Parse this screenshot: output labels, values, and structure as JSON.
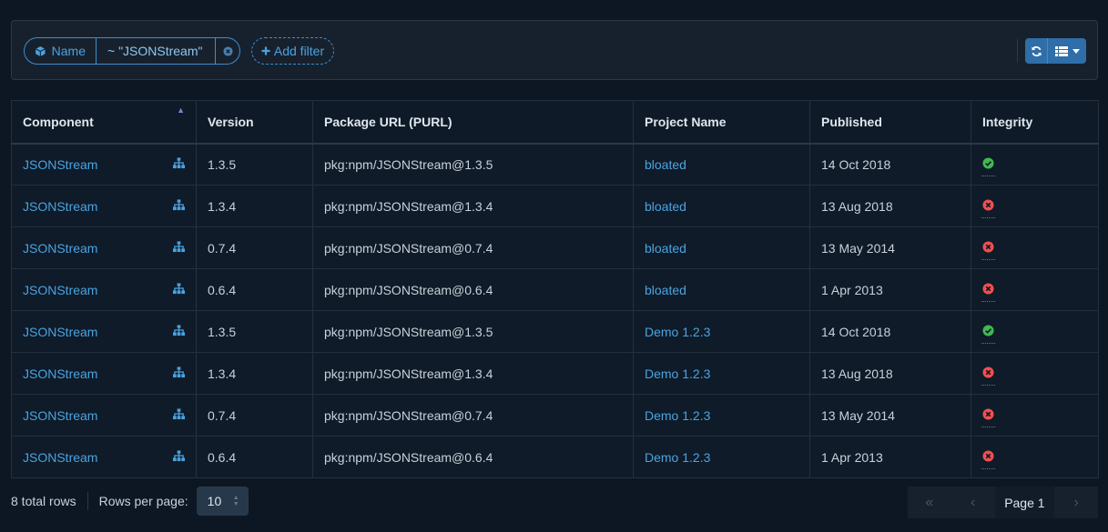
{
  "filter": {
    "field_label": "Name",
    "value": "~ \"JSONStream\"",
    "add_label": "Add filter"
  },
  "table": {
    "headers": [
      "Component",
      "Version",
      "Package URL (PURL)",
      "Project Name",
      "Published",
      "Integrity"
    ],
    "rows": [
      {
        "component": "JSONStream",
        "version": "1.3.5",
        "purl": "pkg:npm/JSONStream@1.3.5",
        "project": "bloated",
        "published": "14 Oct 2018",
        "integrity": "pass"
      },
      {
        "component": "JSONStream",
        "version": "1.3.4",
        "purl": "pkg:npm/JSONStream@1.3.4",
        "project": "bloated",
        "published": "13 Aug 2018",
        "integrity": "fail"
      },
      {
        "component": "JSONStream",
        "version": "0.7.4",
        "purl": "pkg:npm/JSONStream@0.7.4",
        "project": "bloated",
        "published": "13 May 2014",
        "integrity": "fail"
      },
      {
        "component": "JSONStream",
        "version": "0.6.4",
        "purl": "pkg:npm/JSONStream@0.6.4",
        "project": "bloated",
        "published": "1 Apr 2013",
        "integrity": "fail"
      },
      {
        "component": "JSONStream",
        "version": "1.3.5",
        "purl": "pkg:npm/JSONStream@1.3.5",
        "project": "Demo 1.2.3",
        "published": "14 Oct 2018",
        "integrity": "pass"
      },
      {
        "component": "JSONStream",
        "version": "1.3.4",
        "purl": "pkg:npm/JSONStream@1.3.4",
        "project": "Demo 1.2.3",
        "published": "13 Aug 2018",
        "integrity": "fail"
      },
      {
        "component": "JSONStream",
        "version": "0.7.4",
        "purl": "pkg:npm/JSONStream@0.7.4",
        "project": "Demo 1.2.3",
        "published": "13 May 2014",
        "integrity": "fail"
      },
      {
        "component": "JSONStream",
        "version": "0.6.4",
        "purl": "pkg:npm/JSONStream@0.6.4",
        "project": "Demo 1.2.3",
        "published": "1 Apr 2013",
        "integrity": "fail"
      }
    ]
  },
  "footer": {
    "total_rows": "8 total rows",
    "rows_per_page_label": "Rows per page:",
    "rows_per_page_value": "10",
    "page_label": "Page 1"
  },
  "colors": {
    "accent": "#4aa3e0",
    "pass": "#3fb950",
    "fail": "#f0504f",
    "background": "#0d1724"
  },
  "icons": {
    "filter_field": "cube-icon",
    "remove_filter": "close-circle-icon",
    "add_filter": "plus-icon",
    "refresh": "refresh-icon",
    "columns": "list-icon",
    "dependency_graph": "sitemap-icon",
    "integrity_pass": "check-circle-icon",
    "integrity_fail": "x-circle-icon"
  }
}
